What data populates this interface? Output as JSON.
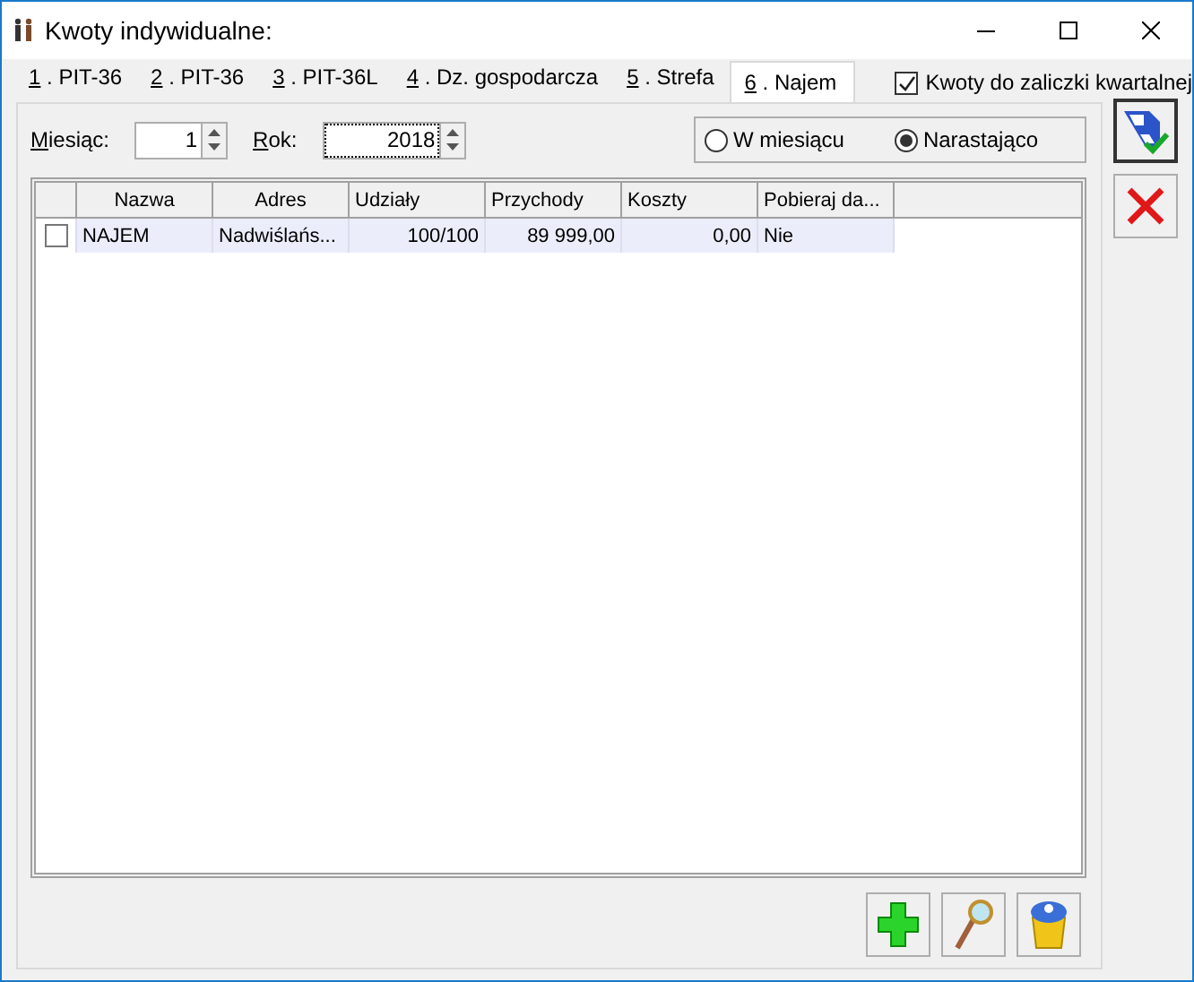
{
  "window": {
    "title": "Kwoty indywidualne:"
  },
  "tabs": [
    {
      "label": "1 . PIT-36",
      "selected": false
    },
    {
      "label": "2 . PIT-36",
      "selected": false
    },
    {
      "label": "3 . PIT-36L",
      "selected": false
    },
    {
      "label": "4 . Dz. gospodarcza",
      "selected": false
    },
    {
      "label": "5 . Strefa",
      "selected": false
    },
    {
      "label": "6 . Najem",
      "selected": true
    }
  ],
  "quarterly": {
    "label": "Kwoty do zaliczki kwartalnej",
    "checked": true
  },
  "month": {
    "label": "Miesiąc:",
    "value": "1"
  },
  "year": {
    "label": "Rok:",
    "value": "2018"
  },
  "mode": [
    {
      "label": "W miesiącu",
      "selected": false
    },
    {
      "label": "Narastająco",
      "selected": true
    }
  ],
  "table": {
    "columns": [
      "Nazwa",
      "Adres",
      "Udziały",
      "Przychody",
      "Koszty",
      "Pobieraj da..."
    ],
    "rows": [
      {
        "checked": false,
        "cells": [
          "NAJEM",
          "Nadwiślańs...",
          "100/100",
          "89 999,00",
          "0,00",
          "Nie"
        ]
      }
    ]
  }
}
